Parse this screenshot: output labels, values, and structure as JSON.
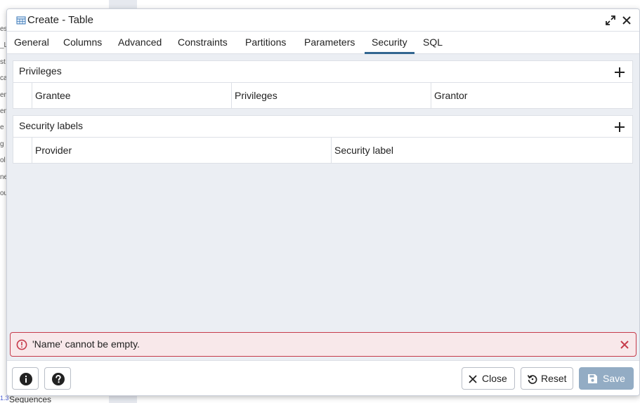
{
  "background": {
    "letters": [
      "es",
      "_La",
      "st",
      "ca",
      "en",
      "en",
      "e",
      "g",
      "ol",
      "ne",
      "ou"
    ],
    "bottom_label": "Sequences",
    "bottom_num": "1.3"
  },
  "dialog": {
    "title": "Create - Table",
    "title_icon": "table-icon"
  },
  "tabs": [
    {
      "label": "General"
    },
    {
      "label": "Columns"
    },
    {
      "label": "Advanced"
    },
    {
      "label": "Constraints"
    },
    {
      "label": "Partitions"
    },
    {
      "label": "Parameters"
    },
    {
      "label": "Security",
      "active": true
    },
    {
      "label": "SQL"
    }
  ],
  "privileges": {
    "title": "Privileges",
    "columns": [
      "Grantee",
      "Privileges",
      "Grantor"
    ]
  },
  "security_labels": {
    "title": "Security labels",
    "columns": [
      "Provider",
      "Security label"
    ]
  },
  "error": {
    "message": "'Name' cannot be empty."
  },
  "footer": {
    "close_label": "Close",
    "reset_label": "Reset",
    "save_label": "Save"
  },
  "colors": {
    "accent": "#326690",
    "error_border": "#c63a4a",
    "error_bg": "#f8e8ea",
    "save_disabled": "#93acc4"
  }
}
